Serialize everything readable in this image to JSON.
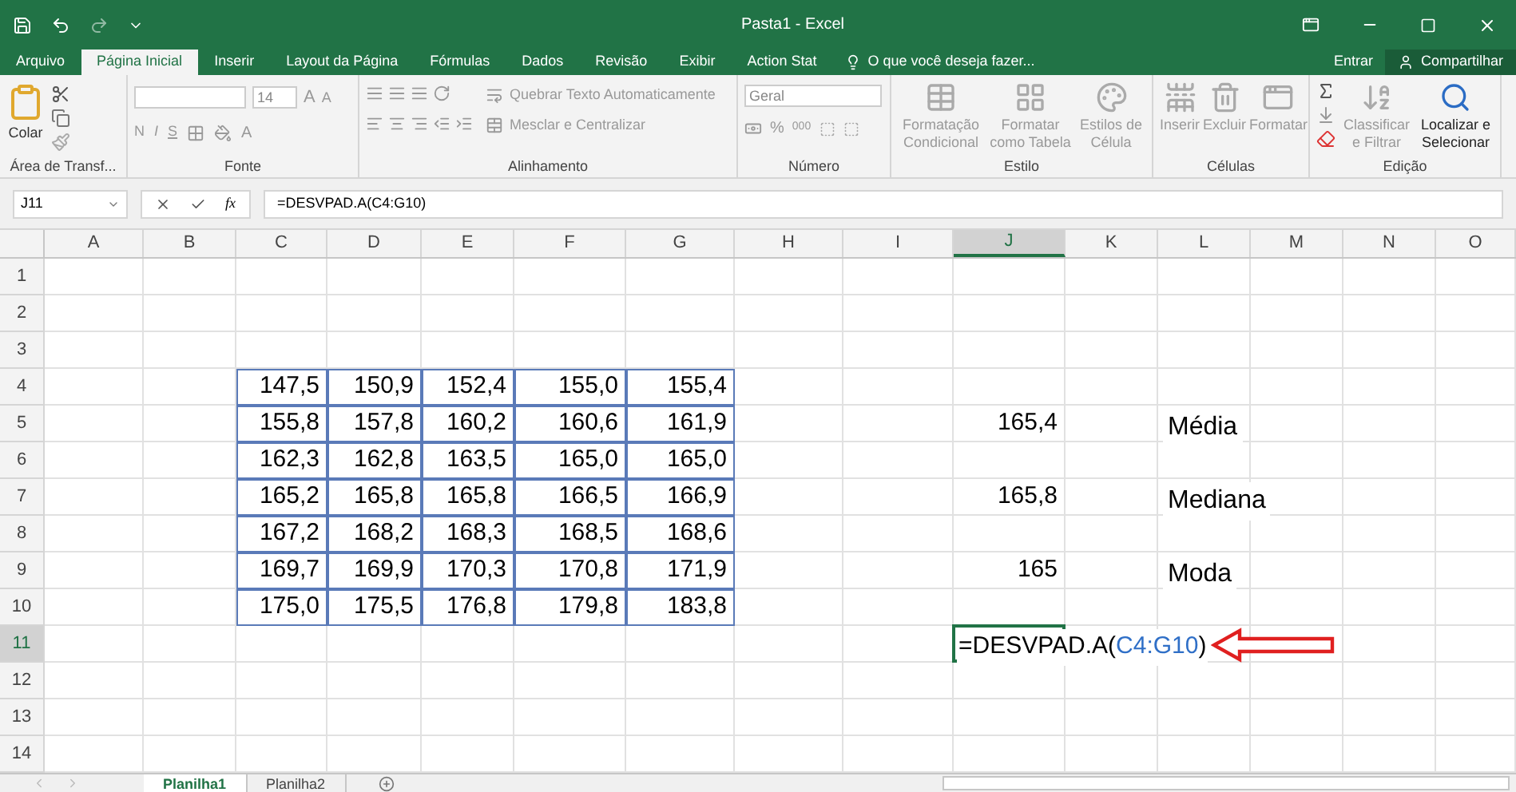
{
  "window": {
    "title": "Pasta1 - Excel"
  },
  "menu_tabs": [
    {
      "label": "Arquivo",
      "selected": false
    },
    {
      "label": "Página Inicial",
      "selected": true
    },
    {
      "label": "Inserir",
      "selected": false
    },
    {
      "label": "Layout da Página",
      "selected": false
    },
    {
      "label": "Fórmulas",
      "selected": false
    },
    {
      "label": "Dados",
      "selected": false
    },
    {
      "label": "Revisão",
      "selected": false
    },
    {
      "label": "Exibir",
      "selected": false
    },
    {
      "label": "Action Stat",
      "selected": false
    }
  ],
  "search": {
    "placeholder": "O que você deseja fazer..."
  },
  "account": {
    "sign_in": "Entrar",
    "share": "Compartilhar"
  },
  "ribbon": {
    "groups": [
      {
        "kind": "clipboard",
        "label": "Área de Transf...",
        "buttons": [
          {
            "label": "Colar",
            "disabled": false
          }
        ]
      },
      {
        "kind": "font",
        "label": "Fonte",
        "font_size": "14",
        "size_buttons": [
          "A",
          "A"
        ],
        "style_buttons": [
          "N",
          "I",
          "S"
        ],
        "color_button": "A"
      },
      {
        "kind": "alignment",
        "label": "Alinhamento",
        "buttons": [
          {
            "label": "Quebrar Texto Automaticamente",
            "disabled": true
          },
          {
            "label": "Mesclar e Centralizar",
            "disabled": true
          }
        ]
      },
      {
        "kind": "number",
        "label": "Número",
        "format": "Geral",
        "buttons": [
          {
            "label": "%",
            "disabled": true
          },
          {
            "label": "000",
            "disabled": true
          }
        ]
      },
      {
        "kind": "large",
        "label": "Estilo",
        "buttons": [
          {
            "label": "Formatação Condicional",
            "disabled": true
          },
          {
            "label": "Formatar como Tabela",
            "disabled": true
          },
          {
            "label": "Estilos de Célula",
            "disabled": true
          }
        ]
      },
      {
        "kind": "large",
        "label": "Células",
        "buttons": [
          {
            "label": "Inserir",
            "disabled": true
          },
          {
            "label": "Excluir",
            "disabled": true
          },
          {
            "label": "Formatar",
            "disabled": true
          }
        ]
      },
      {
        "kind": "editing",
        "label": "Edição",
        "buttons": [
          {
            "label": "Classificar e Filtrar",
            "disabled": true
          },
          {
            "label": "Localizar e Selecionar",
            "disabled": false
          }
        ]
      }
    ]
  },
  "formula_bar": {
    "name_box": "J11",
    "function_label": "fx",
    "formula": "=DESVPAD.A(C4:G10)"
  },
  "sheet": {
    "columns": [
      {
        "label": "A",
        "selected": false
      },
      {
        "label": "B",
        "selected": false
      },
      {
        "label": "C",
        "selected": false
      },
      {
        "label": "D",
        "selected": false
      },
      {
        "label": "E",
        "selected": false
      },
      {
        "label": "F",
        "selected": false
      },
      {
        "label": "G",
        "selected": false
      },
      {
        "label": "H",
        "selected": false
      },
      {
        "label": "I",
        "selected": false
      },
      {
        "label": "J",
        "selected": true
      },
      {
        "label": "K",
        "selected": false
      },
      {
        "label": "L",
        "selected": false
      },
      {
        "label": "M",
        "selected": false
      },
      {
        "label": "N",
        "selected": false
      },
      {
        "label": "O",
        "selected": false
      }
    ],
    "rows": [
      {
        "label": "1",
        "selected": false,
        "cells": [
          "",
          "",
          "",
          "",
          "",
          "",
          "",
          "",
          "",
          "",
          "",
          "",
          "",
          "",
          ""
        ]
      },
      {
        "label": "2",
        "selected": false,
        "cells": [
          "",
          "",
          "",
          "",
          "",
          "",
          "",
          "",
          "",
          "",
          "",
          "",
          "",
          "",
          ""
        ]
      },
      {
        "label": "3",
        "selected": false,
        "cells": [
          "",
          "",
          "",
          "",
          "",
          "",
          "",
          "",
          "",
          "",
          "",
          "",
          "",
          "",
          ""
        ]
      },
      {
        "label": "4",
        "selected": false,
        "cells": [
          "",
          "",
          {
            "kind": "data",
            "text": "147,5"
          },
          {
            "kind": "data",
            "text": "150,9"
          },
          {
            "kind": "data",
            "text": "152,4"
          },
          {
            "kind": "data",
            "text": "155,0"
          },
          {
            "kind": "data",
            "text": "155,4"
          },
          "",
          "",
          "",
          "",
          "",
          "",
          "",
          ""
        ]
      },
      {
        "label": "5",
        "selected": false,
        "cells": [
          "",
          "",
          {
            "kind": "data",
            "text": "155,8"
          },
          {
            "kind": "data",
            "text": "157,8"
          },
          {
            "kind": "data",
            "text": "160,2"
          },
          {
            "kind": "data",
            "text": "160,6"
          },
          {
            "kind": "data",
            "text": "161,9"
          },
          "",
          "",
          {
            "kind": "value",
            "text": "165,4"
          },
          "",
          {
            "kind": "label",
            "text": "Média"
          },
          "",
          "",
          ""
        ]
      },
      {
        "label": "6",
        "selected": false,
        "cells": [
          "",
          "",
          {
            "kind": "data",
            "text": "162,3"
          },
          {
            "kind": "data",
            "text": "162,8"
          },
          {
            "kind": "data",
            "text": "163,5"
          },
          {
            "kind": "data",
            "text": "165,0"
          },
          {
            "kind": "data",
            "text": "165,0"
          },
          "",
          "",
          "",
          "",
          "",
          "",
          "",
          ""
        ]
      },
      {
        "label": "7",
        "selected": false,
        "cells": [
          "",
          "",
          {
            "kind": "data",
            "text": "165,2"
          },
          {
            "kind": "data",
            "text": "165,8"
          },
          {
            "kind": "data",
            "text": "165,8"
          },
          {
            "kind": "data",
            "text": "166,5"
          },
          {
            "kind": "data",
            "text": "166,9"
          },
          "",
          "",
          {
            "kind": "value",
            "text": "165,8"
          },
          "",
          {
            "kind": "label",
            "text": "Mediana"
          },
          "",
          "",
          ""
        ]
      },
      {
        "label": "8",
        "selected": false,
        "cells": [
          "",
          "",
          {
            "kind": "data",
            "text": "167,2"
          },
          {
            "kind": "data",
            "text": "168,2"
          },
          {
            "kind": "data",
            "text": "168,3"
          },
          {
            "kind": "data",
            "text": "168,5"
          },
          {
            "kind": "data",
            "text": "168,6"
          },
          "",
          "",
          "",
          "",
          "",
          "",
          "",
          ""
        ]
      },
      {
        "label": "9",
        "selected": false,
        "cells": [
          "",
          "",
          {
            "kind": "data",
            "text": "169,7"
          },
          {
            "kind": "data",
            "text": "169,9"
          },
          {
            "kind": "data",
            "text": "170,3"
          },
          {
            "kind": "data",
            "text": "170,8"
          },
          {
            "kind": "data",
            "text": "171,9"
          },
          "",
          "",
          {
            "kind": "value",
            "text": "165"
          },
          "",
          {
            "kind": "label",
            "text": "Moda"
          },
          "",
          "",
          ""
        ]
      },
      {
        "label": "10",
        "selected": false,
        "cells": [
          "",
          "",
          {
            "kind": "data",
            "text": "175,0"
          },
          {
            "kind": "data",
            "text": "175,5"
          },
          {
            "kind": "data",
            "text": "176,8"
          },
          {
            "kind": "data",
            "text": "179,8"
          },
          {
            "kind": "data",
            "text": "183,8"
          },
          "",
          "",
          "",
          "",
          "",
          "",
          "",
          ""
        ]
      },
      {
        "label": "11",
        "selected": true,
        "cells": [
          "",
          "",
          "",
          "",
          "",
          "",
          "",
          "",
          "",
          {
            "kind": "formula",
            "text": "=DESVPAD.A(",
            "reference": "C4:G10",
            "suffix": ")"
          },
          "",
          "",
          "",
          "",
          ""
        ]
      },
      {
        "label": "12",
        "selected": false,
        "cells": [
          "",
          "",
          "",
          "",
          "",
          "",
          "",
          "",
          "",
          "",
          "",
          "",
          "",
          "",
          ""
        ]
      },
      {
        "label": "13",
        "selected": false,
        "cells": [
          "",
          "",
          "",
          "",
          "",
          "",
          "",
          "",
          "",
          "",
          "",
          "",
          "",
          "",
          ""
        ]
      },
      {
        "label": "14",
        "selected": false,
        "cells": [
          "",
          "",
          "",
          "",
          "",
          "",
          "",
          "",
          "",
          "",
          "",
          "",
          "",
          "",
          ""
        ]
      }
    ]
  },
  "sheet_tabs": [
    {
      "label": "Planilha1",
      "selected": true
    },
    {
      "label": "Planilha2",
      "selected": false
    }
  ]
}
